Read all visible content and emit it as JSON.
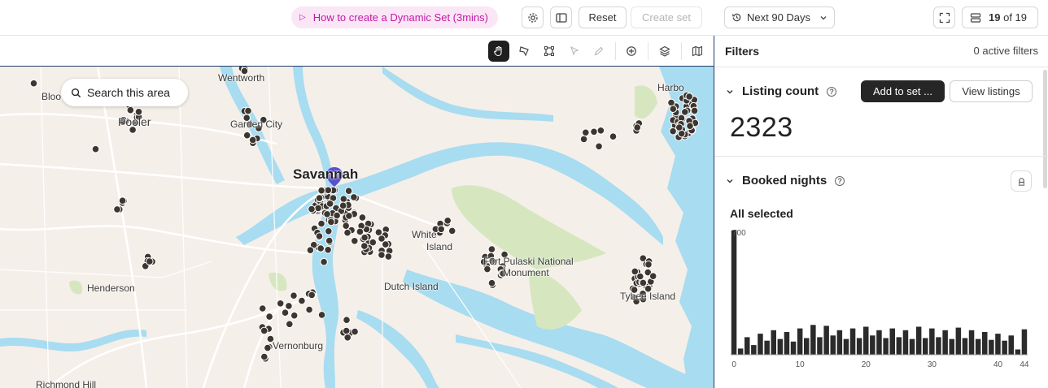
{
  "topbar": {
    "tutorial_label": "How to create a Dynamic Set (3mins)",
    "reset_label": "Reset",
    "create_set_label": "Create set",
    "date_range": "Next 90 Days",
    "counter_current": "19",
    "counter_of": "of 19",
    "accent_color": "#c21aa3"
  },
  "map": {
    "search_area_label": "Search this area",
    "labels": {
      "wentworth": "Wentworth",
      "bloomingdale": "Bloo",
      "pooler": "Pooler",
      "garden_city": "Garden City",
      "savannah": "Savannah",
      "white_island": "White",
      "white_island_2": "Island",
      "fort_pulaski": "Fort Pulaski National",
      "fort_pulaski_2": "Monument",
      "dutch_island": "Dutch Island",
      "henderson": "Henderson",
      "vernonburg": "Vernonburg",
      "richmond_hill": "Richmond Hill",
      "tybee_island": "Tybee Island",
      "harbor": "Harbo"
    },
    "pin_color": "#5a4fcf",
    "water_color": "#a8dcf0",
    "land_color": "#f5efe9",
    "marker_color": "#3d3630"
  },
  "panel": {
    "title": "Filters",
    "active_filters": "0 active filters",
    "listing_count": {
      "heading": "Listing count",
      "add_to_set_label": "Add to set ...",
      "view_listings_label": "View listings",
      "value": "2323"
    },
    "booked_nights": {
      "heading": "Booked nights",
      "selection_label": "All selected",
      "y_max_label": "700",
      "x_ticks": [
        "0",
        "10",
        "20",
        "30",
        "40",
        "44"
      ]
    }
  },
  "chart_data": {
    "type": "bar",
    "title": "Booked nights",
    "ylabel": "",
    "xlabel": "",
    "ylim": [
      0,
      700
    ],
    "x": [
      0,
      1,
      2,
      3,
      4,
      5,
      6,
      7,
      8,
      9,
      10,
      11,
      12,
      13,
      14,
      15,
      16,
      17,
      18,
      19,
      20,
      21,
      22,
      23,
      24,
      25,
      26,
      27,
      28,
      29,
      30,
      31,
      32,
      33,
      34,
      35,
      36,
      37,
      38,
      39,
      40,
      41,
      42,
      43,
      44
    ],
    "values": [
      710,
      35,
      100,
      55,
      120,
      80,
      140,
      90,
      130,
      75,
      150,
      95,
      170,
      100,
      165,
      110,
      140,
      90,
      150,
      95,
      160,
      110,
      140,
      95,
      150,
      100,
      140,
      90,
      160,
      95,
      150,
      100,
      140,
      90,
      155,
      95,
      140,
      90,
      130,
      85,
      120,
      80,
      110,
      30,
      145
    ]
  }
}
